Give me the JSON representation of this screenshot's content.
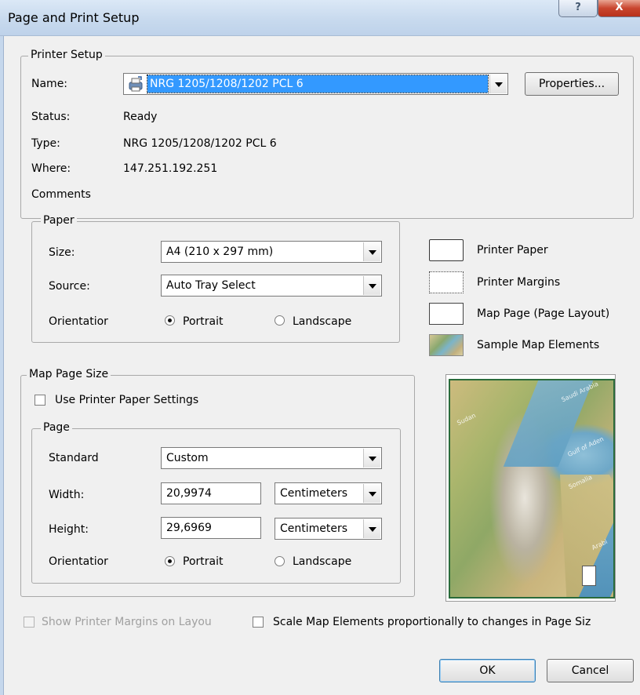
{
  "window": {
    "title": "Page and Print Setup",
    "help_label": "?",
    "close_label": "X"
  },
  "printer_setup": {
    "legend": "Printer Setup",
    "name_label": "Name:",
    "name_value": "NRG 1205/1208/1202 PCL 6",
    "properties_label": "Properties...",
    "status_label": "Status:",
    "status_value": "Ready",
    "type_label": "Type:",
    "type_value": "NRG 1205/1208/1202 PCL 6",
    "where_label": "Where:",
    "where_value": "147.251.192.251",
    "comments_label": "Comments"
  },
  "paper": {
    "legend": "Paper",
    "size_label": "Size:",
    "size_value": "A4 (210 x 297 mm)",
    "source_label": "Source:",
    "source_value": "Auto Tray Select",
    "orientation_label": "Orientatior",
    "portrait_label": "Portrait",
    "landscape_label": "Landscape",
    "selected_orientation": "Portrait"
  },
  "legend_panel": {
    "printer_paper": "Printer Paper",
    "printer_margins": "Printer Margins",
    "map_page": "Map Page (Page Layout)",
    "sample_elements": "Sample Map Elements"
  },
  "preview": {
    "labels": [
      "Saudi Arabia",
      "Sudan",
      "Gulf of Aden",
      "Somalia",
      "Arabi"
    ]
  },
  "map_page_size": {
    "legend": "Map Page Size",
    "use_printer_label": "Use Printer Paper Settings",
    "use_printer_checked": false,
    "page_legend": "Page",
    "standard_label": "Standard",
    "standard_value": "Custom",
    "width_label": "Width:",
    "width_value": "20,9974",
    "width_unit": "Centimeters",
    "height_label": "Height:",
    "height_value": "29,6969",
    "height_unit": "Centimeters",
    "orientation_label": "Orientatior",
    "portrait_label": "Portrait",
    "landscape_label": "Landscape",
    "selected_orientation": "Portrait"
  },
  "options": {
    "show_margins_label": "Show Printer Margins on Layou",
    "show_margins_enabled": false,
    "scale_elements_label": "Scale Map Elements proportionally to changes in Page Siz",
    "scale_elements_checked": false
  },
  "buttons": {
    "ok": "OK",
    "cancel": "Cancel"
  },
  "colors": {
    "selection": "#3399ff",
    "titlebar": "#c8daee",
    "close": "#c9452e"
  }
}
